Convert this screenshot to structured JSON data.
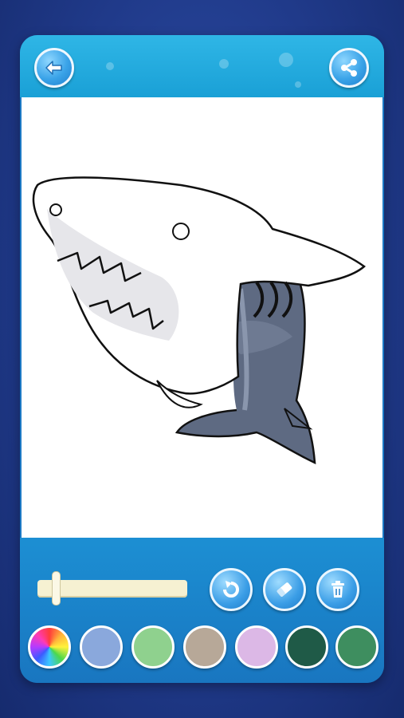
{
  "toolbar": {
    "back_icon": "arrow-left-icon",
    "share_icon": "share-icon"
  },
  "drawing": {
    "subject": "shark-outline",
    "colors": {
      "body": "#5e6a82",
      "belly_shade": "#e5e5ea",
      "outline": "#111111"
    }
  },
  "brush_size": {
    "value_fraction": 0.12
  },
  "tools": [
    {
      "name": "undo",
      "icon": "undo-icon"
    },
    {
      "name": "eraser",
      "icon": "eraser-icon"
    },
    {
      "name": "delete",
      "icon": "trash-icon"
    }
  ],
  "palette": {
    "selected": "rainbow",
    "swatches": [
      "rainbow",
      "#8aa8dc",
      "#8fd18e",
      "#b7a898",
      "#dcb8e6",
      "#1f5a47",
      "#3e8e5f"
    ]
  },
  "theme": {
    "accent": "#1aa0d6",
    "background": "#203a8a"
  }
}
